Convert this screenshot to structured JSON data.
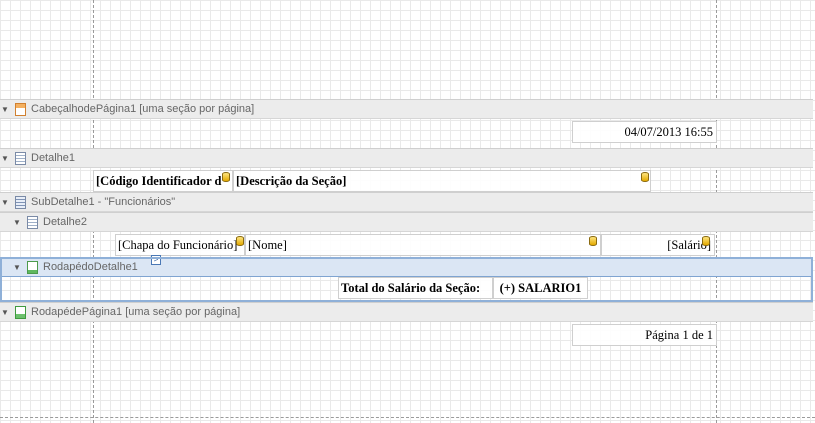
{
  "bands": {
    "page_header": {
      "label": "CabeçalhodePágina1 [uma seção por página]",
      "icon": "page-header-band-icon"
    },
    "detail1": {
      "label": "Detalhe1",
      "icon": "detail-band-icon"
    },
    "subdetail1": {
      "label": "SubDetalhe1 - \"Funcionários\"",
      "icon": "subreport-band-icon"
    },
    "detail2": {
      "label": "Detalhe2",
      "icon": "detail-band-icon"
    },
    "group_footer": {
      "label": "RodapédoDetalhe1",
      "icon": "group-footer-band-icon"
    },
    "page_footer": {
      "label": "RodapédePágina1 [uma seção por página]",
      "icon": "page-footer-band-icon"
    }
  },
  "fields": {
    "datetime": "04/07/2013 16:55",
    "codigo": "[Código Identificador d",
    "descricao": "[Descrição da Seção]",
    "chapa": "[Chapa do Funcionário]",
    "nome": "[Nome]",
    "salario": "[Salário]",
    "total_label": "Total do Salário da Seção:",
    "total_value": "(+) SALARIO1",
    "page_number": "Página 1 de 1"
  },
  "icons": {
    "collapse": "▼",
    "smart_tag": ">"
  }
}
